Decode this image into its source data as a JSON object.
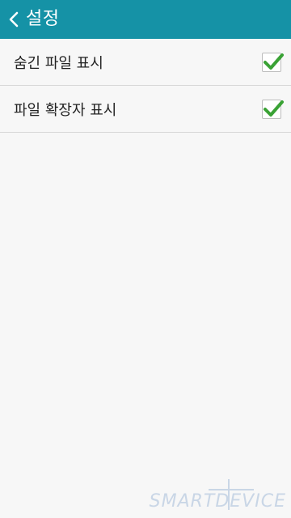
{
  "app_bar": {
    "title": "설정",
    "back_icon": "chevron-left-icon",
    "background_color": "#1592a6"
  },
  "settings": [
    {
      "label": "숨긴 파일 표시",
      "checked": true
    },
    {
      "label": "파일 확장자 표시",
      "checked": true
    }
  ],
  "check_color": "#3aa235",
  "watermark": {
    "text": "SMARTDEVICE"
  }
}
